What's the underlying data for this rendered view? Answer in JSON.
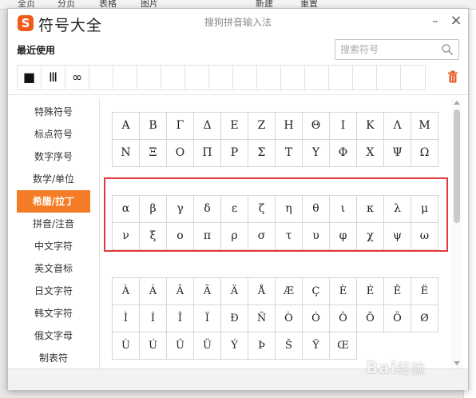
{
  "background": {
    "tabs": [
      "全页",
      "分页",
      "表格",
      "图片",
      "新建",
      "重置"
    ]
  },
  "dialog": {
    "logo_letter": "S",
    "title": "符号大全",
    "ime_name": "搜狗拼音输入法",
    "minimize_label": "–",
    "close_label": "×",
    "recent_label": "最近使用",
    "search_placeholder": "搜索符号",
    "recent_symbols": [
      "■",
      "Ⅲ",
      "∞",
      "",
      "",
      "",
      "",
      "",
      "",
      "",
      "",
      "",
      "",
      "",
      "",
      "",
      ""
    ],
    "accent_color": "#f57c26",
    "highlight_color": "#e23a3a"
  },
  "sidebar": {
    "items": [
      {
        "label": "特殊符号",
        "active": false
      },
      {
        "label": "标点符号",
        "active": false
      },
      {
        "label": "数字序号",
        "active": false
      },
      {
        "label": "数学/单位",
        "active": false
      },
      {
        "label": "希腊/拉丁",
        "active": true
      },
      {
        "label": "拼音/注音",
        "active": false
      },
      {
        "label": "中文字符",
        "active": false
      },
      {
        "label": "英文音标",
        "active": false
      },
      {
        "label": "日文字符",
        "active": false
      },
      {
        "label": "韩文字符",
        "active": false
      },
      {
        "label": "俄文字母",
        "active": false
      },
      {
        "label": "制表符",
        "active": false
      }
    ]
  },
  "symbols": {
    "greek_upper": [
      "Α",
      "Β",
      "Γ",
      "Δ",
      "Ε",
      "Ζ",
      "Η",
      "Θ",
      "Ι",
      "Κ",
      "Λ",
      "Μ",
      "Ν",
      "Ξ",
      "Ο",
      "Π",
      "Ρ",
      "Σ",
      "Τ",
      "Υ",
      "Φ",
      "Χ",
      "Ψ",
      "Ω"
    ],
    "greek_lower": [
      "α",
      "β",
      "γ",
      "δ",
      "ε",
      "ζ",
      "η",
      "θ",
      "ι",
      "κ",
      "λ",
      "μ",
      "ν",
      "ξ",
      "ο",
      "π",
      "ρ",
      "σ",
      "τ",
      "υ",
      "φ",
      "χ",
      "ψ",
      "ω"
    ],
    "latin": [
      "À",
      "Á",
      "Â",
      "Ã",
      "Ä",
      "Å",
      "Æ",
      "Ç",
      "È",
      "É",
      "Ê",
      "Ë",
      "Ì",
      "Í",
      "Î",
      "Ï",
      "Ð",
      "Ñ",
      "Ò",
      "Ó",
      "Ô",
      "Õ",
      "Ö",
      "Ø",
      "Ù",
      "Ú",
      "Û",
      "Ü",
      "Ý",
      "Þ",
      "Š",
      "Ÿ",
      "Œ"
    ]
  },
  "watermark": {
    "text": "Bai",
    "cn": "经验"
  }
}
